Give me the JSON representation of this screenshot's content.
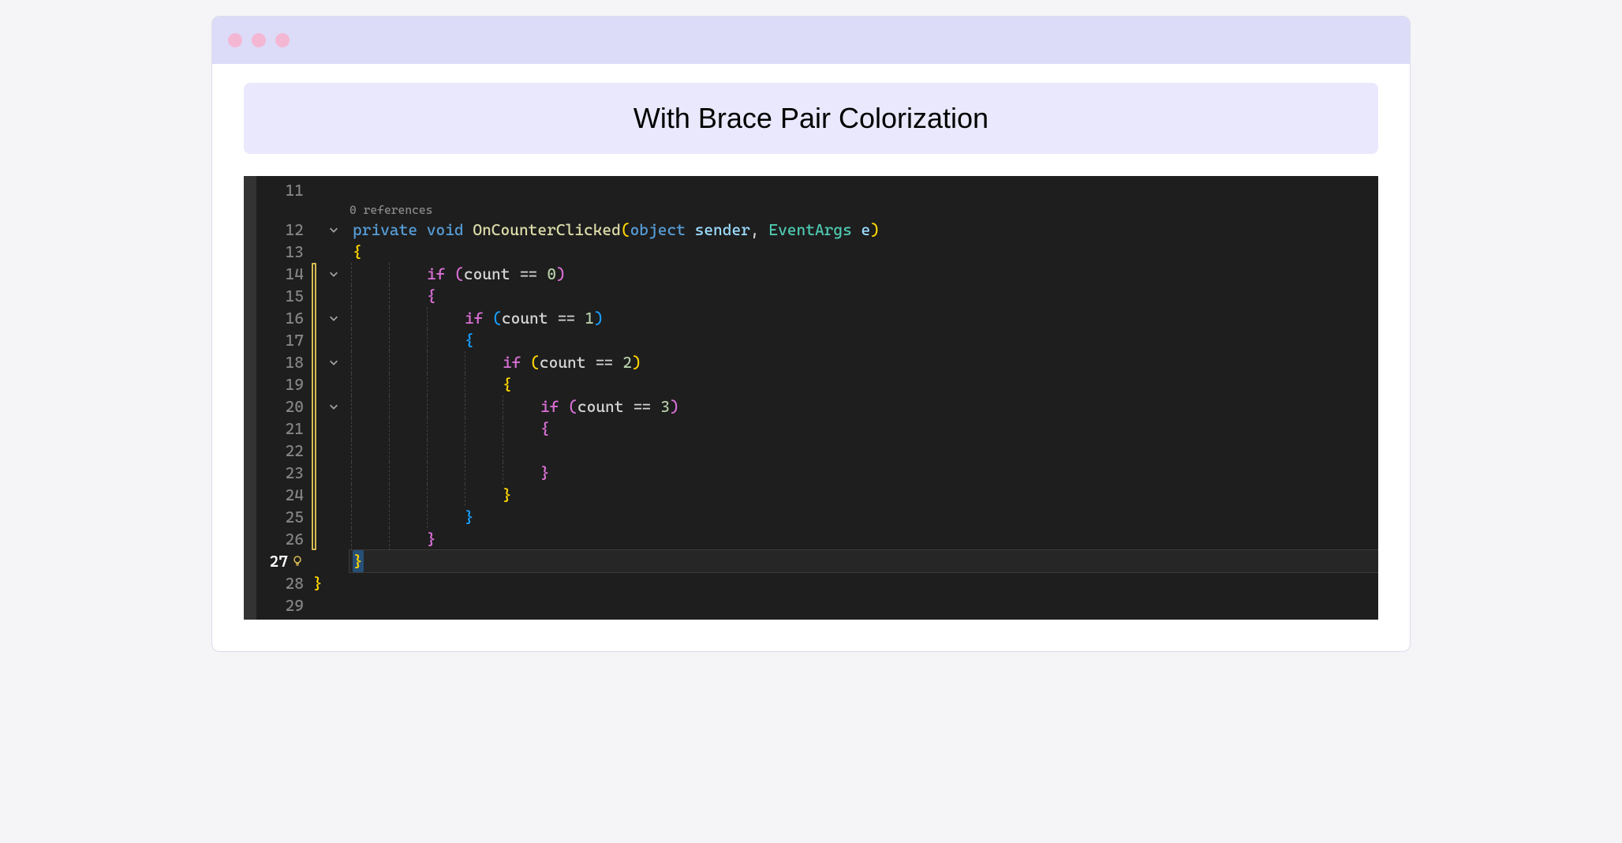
{
  "banner": {
    "title": "With Brace Pair Colorization"
  },
  "colors": {
    "brace1": "#ffd700",
    "brace2": "#da70d6",
    "brace3": "#179fff"
  },
  "editor": {
    "codelens": "0 references",
    "active_line": 27,
    "yellow_range": {
      "start": 14,
      "end": 26
    },
    "lines": [
      {
        "num": 11,
        "fold": false,
        "tokens": []
      },
      {
        "num": 12,
        "fold": true,
        "codelens": true,
        "tokens": [
          {
            "t": "private",
            "c": "kw"
          },
          {
            "t": " ",
            "c": "op"
          },
          {
            "t": "void",
            "c": "kw"
          },
          {
            "t": " ",
            "c": "op"
          },
          {
            "t": "OnCounterClicked",
            "c": "method"
          },
          {
            "t": "(",
            "c": "br1"
          },
          {
            "t": "object",
            "c": "kw"
          },
          {
            "t": " ",
            "c": "op"
          },
          {
            "t": "sender",
            "c": "param"
          },
          {
            "t": ", ",
            "c": "op"
          },
          {
            "t": "EventArgs",
            "c": "type"
          },
          {
            "t": " ",
            "c": "op"
          },
          {
            "t": "e",
            "c": "param"
          },
          {
            "t": ")",
            "c": "br1"
          }
        ]
      },
      {
        "num": 13,
        "fold": false,
        "tokens": [
          {
            "t": "{",
            "c": "br1"
          }
        ]
      },
      {
        "num": 14,
        "fold": true,
        "tokens": [
          {
            "indent": 1
          },
          {
            "t": "if",
            "c": "br2 kw-if"
          },
          {
            "t": " ",
            "c": "op"
          },
          {
            "t": "(",
            "c": "br2"
          },
          {
            "t": "count",
            "c": "id"
          },
          {
            "t": " == ",
            "c": "op"
          },
          {
            "t": "0",
            "c": "num"
          },
          {
            "t": ")",
            "c": "br2"
          }
        ]
      },
      {
        "num": 15,
        "fold": false,
        "tokens": [
          {
            "indent": 1
          },
          {
            "t": "{",
            "c": "br2"
          }
        ]
      },
      {
        "num": 16,
        "fold": true,
        "tokens": [
          {
            "indent": 2
          },
          {
            "t": "if",
            "c": "br2 kw-if"
          },
          {
            "t": " ",
            "c": "op"
          },
          {
            "t": "(",
            "c": "br3"
          },
          {
            "t": "count",
            "c": "id"
          },
          {
            "t": " == ",
            "c": "op"
          },
          {
            "t": "1",
            "c": "num"
          },
          {
            "t": ")",
            "c": "br3"
          }
        ]
      },
      {
        "num": 17,
        "fold": false,
        "tokens": [
          {
            "indent": 2
          },
          {
            "t": "{",
            "c": "br3"
          }
        ]
      },
      {
        "num": 18,
        "fold": true,
        "tokens": [
          {
            "indent": 3
          },
          {
            "t": "if",
            "c": "br2 kw-if"
          },
          {
            "t": " ",
            "c": "op"
          },
          {
            "t": "(",
            "c": "br1"
          },
          {
            "t": "count",
            "c": "id"
          },
          {
            "t": " == ",
            "c": "op"
          },
          {
            "t": "2",
            "c": "num"
          },
          {
            "t": ")",
            "c": "br1"
          }
        ]
      },
      {
        "num": 19,
        "fold": false,
        "tokens": [
          {
            "indent": 3
          },
          {
            "t": "{",
            "c": "br1"
          }
        ]
      },
      {
        "num": 20,
        "fold": true,
        "tokens": [
          {
            "indent": 4
          },
          {
            "t": "if",
            "c": "br2 kw-if"
          },
          {
            "t": " ",
            "c": "op"
          },
          {
            "t": "(",
            "c": "br2"
          },
          {
            "t": "count",
            "c": "id"
          },
          {
            "t": " == ",
            "c": "op"
          },
          {
            "t": "3",
            "c": "num"
          },
          {
            "t": ")",
            "c": "br2"
          }
        ]
      },
      {
        "num": 21,
        "fold": false,
        "tokens": [
          {
            "indent": 4
          },
          {
            "t": "{",
            "c": "br2"
          }
        ]
      },
      {
        "num": 22,
        "fold": false,
        "tokens": [
          {
            "indent": 4
          }
        ]
      },
      {
        "num": 23,
        "fold": false,
        "tokens": [
          {
            "indent": 4
          },
          {
            "t": "}",
            "c": "br2"
          }
        ]
      },
      {
        "num": 24,
        "fold": false,
        "tokens": [
          {
            "indent": 3
          },
          {
            "t": "}",
            "c": "br1"
          }
        ]
      },
      {
        "num": 25,
        "fold": false,
        "tokens": [
          {
            "indent": 2
          },
          {
            "t": "}",
            "c": "br3"
          }
        ]
      },
      {
        "num": 26,
        "fold": false,
        "tokens": [
          {
            "indent": 1
          },
          {
            "t": "}",
            "c": "br2"
          }
        ]
      },
      {
        "num": 27,
        "fold": false,
        "bulb": true,
        "active": true,
        "tokens": [
          {
            "t": "}",
            "c": "br1 sel"
          }
        ]
      },
      {
        "num": 28,
        "fold": false,
        "tokens": [
          {
            "indent": -1
          },
          {
            "t": "}",
            "c": "br1 outer"
          }
        ]
      },
      {
        "num": 29,
        "fold": false,
        "tokens": []
      }
    ]
  }
}
